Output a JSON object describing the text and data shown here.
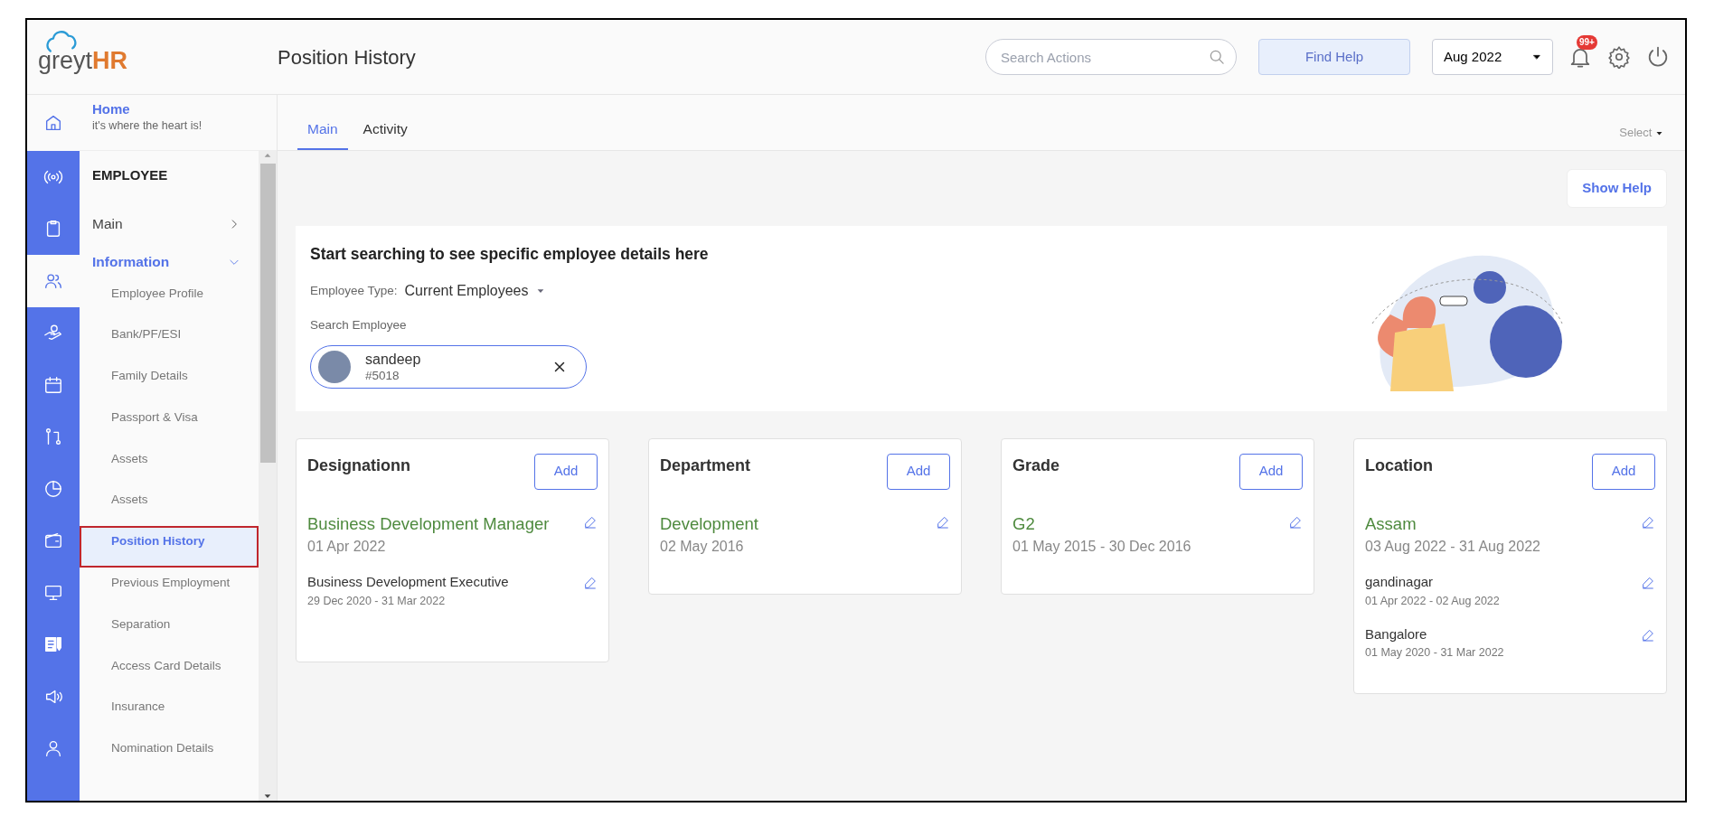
{
  "brand": {
    "text": "greyt",
    "accent": "HR"
  },
  "header": {
    "title": "Position History",
    "search": {
      "placeholder": "Search Actions"
    },
    "help_button": "Find Help",
    "period": "Aug 2022",
    "notifications": "99+"
  },
  "home": {
    "title": "Home",
    "subtitle": "it's where the heart is!"
  },
  "rail": [
    {
      "kind": "broadcast",
      "selected": false
    },
    {
      "kind": "clipboard",
      "selected": false
    },
    {
      "kind": "users",
      "selected": true
    },
    {
      "kind": "hand",
      "selected": false
    },
    {
      "kind": "calendar",
      "selected": false
    },
    {
      "kind": "flow",
      "selected": false
    },
    {
      "kind": "pie",
      "selected": false
    },
    {
      "kind": "wallet",
      "selected": false
    },
    {
      "kind": "monitor",
      "selected": false
    },
    {
      "kind": "document",
      "selected": false
    },
    {
      "kind": "speaker",
      "selected": false
    },
    {
      "kind": "person",
      "selected": false
    }
  ],
  "nav": {
    "section": "EMPLOYEE",
    "groups": [
      {
        "label": "Main",
        "expanded": false
      },
      {
        "label": "Information",
        "expanded": true,
        "items": [
          {
            "label": "Employee Profile",
            "selected": false
          },
          {
            "label": "Bank/PF/ESI",
            "selected": false
          },
          {
            "label": "Family Details",
            "selected": false
          },
          {
            "label": "Passport & Visa",
            "selected": false
          },
          {
            "label": "Assets",
            "selected": false
          },
          {
            "label": "Assets",
            "selected": false
          },
          {
            "label": "Position History",
            "selected": true
          },
          {
            "label": "Previous Employment",
            "selected": false
          },
          {
            "label": "Separation",
            "selected": false
          },
          {
            "label": "Access Card Details",
            "selected": false
          },
          {
            "label": "Insurance",
            "selected": false
          },
          {
            "label": "Nomination Details",
            "selected": false
          }
        ]
      }
    ]
  },
  "tabs": [
    {
      "label": "Main",
      "selected": true
    },
    {
      "label": "Activity",
      "selected": false
    }
  ],
  "select_menu": "Select",
  "show_help": "Show Help",
  "search_panel": {
    "heading": "Start searching to see specific employee details here",
    "type_label": "Employee Type:",
    "type_value": "Current Employees",
    "search_label": "Search Employee",
    "employee": {
      "name": "sandeep",
      "id": "#5018"
    }
  },
  "cards": [
    {
      "title": "Designationn",
      "add": "Add",
      "entries": [
        {
          "value": "Business Development Manager",
          "date": "01 Apr 2022",
          "current": true
        },
        {
          "value": "Business Development Executive",
          "date": "29 Dec 2020 - 31 Mar 2022",
          "current": false
        }
      ]
    },
    {
      "title": "Department",
      "add": "Add",
      "entries": [
        {
          "value": "Development",
          "date": "02 May 2016",
          "current": true
        }
      ]
    },
    {
      "title": "Grade",
      "add": "Add",
      "entries": [
        {
          "value": "G2",
          "date": "01 May 2015 - 30 Dec 2016",
          "current": true
        }
      ]
    },
    {
      "title": "Location",
      "add": "Add",
      "entries": [
        {
          "value": "Assam",
          "date": "03 Aug 2022 - 31 Aug 2022",
          "current": true
        },
        {
          "value": "gandinagar",
          "date": "01 Apr 2022 - 02 Aug 2022",
          "current": false
        },
        {
          "value": "Bangalore",
          "date": "01 May 2020 - 31 Mar 2022",
          "current": false
        }
      ]
    }
  ]
}
